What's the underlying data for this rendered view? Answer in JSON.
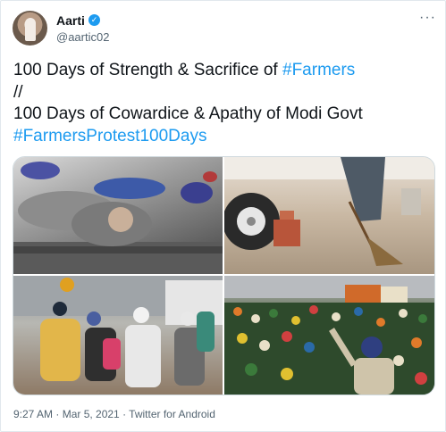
{
  "author": {
    "name": "Aarti",
    "handle": "@aartic02"
  },
  "tweet": {
    "line1_text": "100 Days of Strength & Sacrifice of ",
    "line1_tag": "#Farmers",
    "line2": "//",
    "line3": "100 Days of Cowardice & Apathy of Modi Govt",
    "line4_tag": "#FarmersProtest100Days"
  },
  "meta": {
    "timestamp": "9:27 AM · Mar 5, 2021 · Twitter for Android"
  },
  "icons": {
    "verified": "verified-badge-icon",
    "more": "more-options-icon"
  },
  "colors": {
    "link": "#1d9bf0",
    "secondary_text": "#536471",
    "verified": "#1d9bf0"
  }
}
